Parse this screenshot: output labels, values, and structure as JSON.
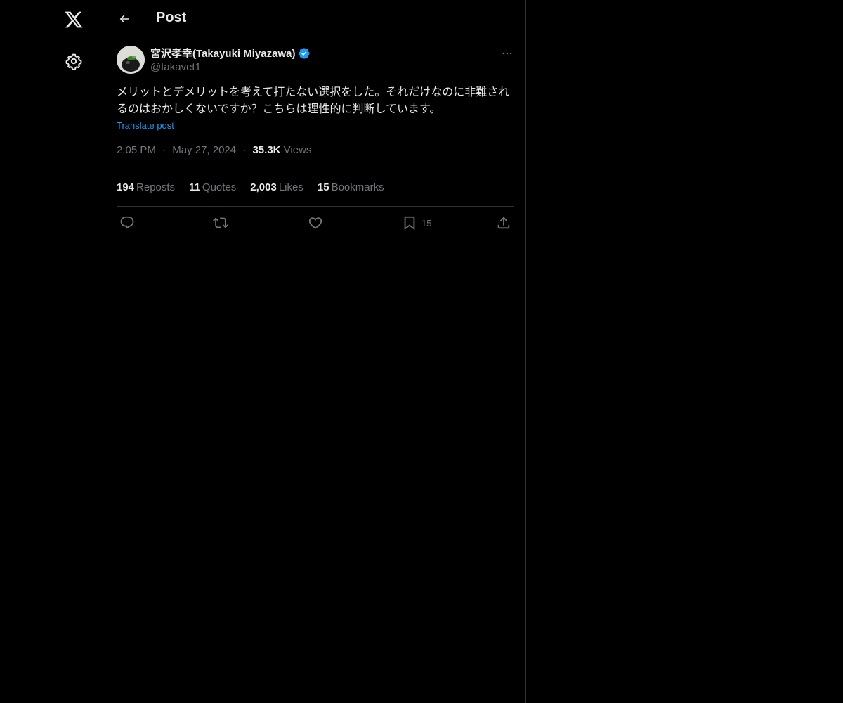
{
  "nav": {
    "logo_icon": "x-logo-icon",
    "settings_icon": "gear-icon"
  },
  "header": {
    "title": "Post"
  },
  "post": {
    "author": {
      "name": "宮沢孝幸(Takayuki Miyazawa)",
      "handle": "@takavet1",
      "verified": true
    },
    "text": "メリットとデメリットを考えて打たない選択をした。それだけなのに非難されるのはおかしくないですか？こちらは理性的に判断しています。",
    "translate_label": "Translate post",
    "time": "2:05 PM",
    "date": "May 27, 2024",
    "separator": "·",
    "views_count": "35.3K",
    "views_label": "Views",
    "stats": {
      "reposts_count": "194",
      "reposts_label": "Reposts",
      "quotes_count": "11",
      "quotes_label": "Quotes",
      "likes_count": "2,003",
      "likes_label": "Likes",
      "bookmarks_count": "15",
      "bookmarks_label": "Bookmarks"
    },
    "actions": {
      "reply_icon": "reply-icon",
      "repost_icon": "repost-icon",
      "like_icon": "heart-icon",
      "bookmark_icon": "bookmark-icon",
      "bookmark_count": "15",
      "share_icon": "share-icon"
    }
  },
  "colors": {
    "background": "#000000",
    "text": "#e7e9ea",
    "muted": "#71767b",
    "link": "#1d9bf0",
    "border": "#2f3336",
    "verified": "#1d9bf0"
  }
}
